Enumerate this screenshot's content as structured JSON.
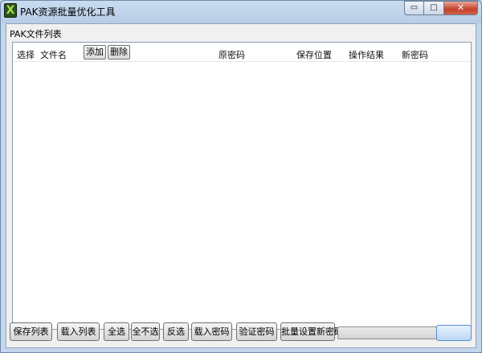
{
  "window": {
    "title": "PAK资源批量优化工具",
    "icon_glyph": "X",
    "controls": {
      "minimize": "▭",
      "maximize": "□",
      "close": "✕"
    }
  },
  "group": {
    "title": "PAK文件列表"
  },
  "list": {
    "columns": {
      "select": "选择",
      "filename": "文件名",
      "old_password": "原密码",
      "save_location": "保存位置",
      "result": "操作结果",
      "new_password": "新密码"
    },
    "add_label": "添加",
    "delete_label": "删除",
    "rows": []
  },
  "buttons": {
    "save_list": "保存列表",
    "load_list": "载入列表",
    "select_all": "全选",
    "select_none": "全不选",
    "invert": "反选",
    "load_password": "载入密码",
    "verify_password": "验证密码",
    "batch_new_password": "批量设置新密码"
  },
  "progress": {
    "value": 0
  },
  "colors": {
    "accent": "#4f8fd6",
    "close": "#c4402a"
  }
}
